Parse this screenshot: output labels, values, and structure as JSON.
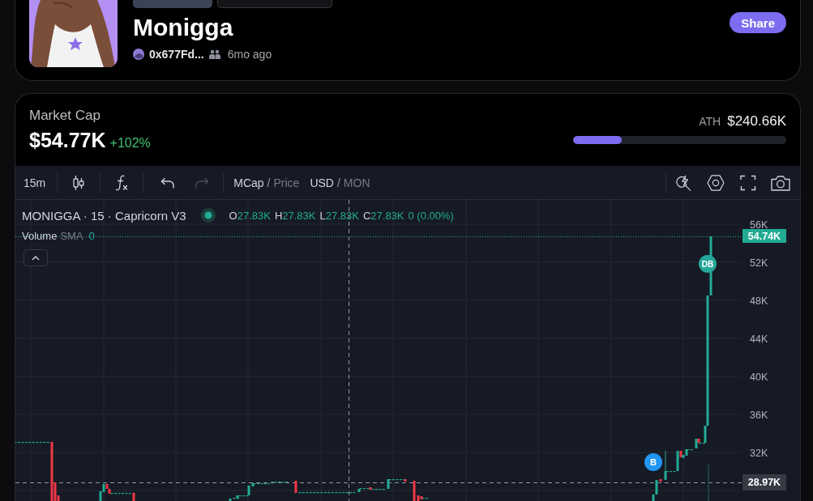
{
  "token": {
    "name": "Monigga",
    "creator": "0x677Fd...",
    "age": "6mo ago"
  },
  "share_button": {
    "label": "Share"
  },
  "market_cap": {
    "label": "Market Cap",
    "value": "$54.77K",
    "change": "+102%"
  },
  "ath": {
    "label": "ATH",
    "value": "$240.66K",
    "level": 0.23
  },
  "toolbar": {
    "interval": "15m",
    "undo": {
      "disabled": false
    },
    "redo": {
      "disabled": true
    },
    "price_mode": {
      "options": [
        {
          "label": "MCap",
          "selected": true
        },
        {
          "label": "Price",
          "selected": false
        }
      ],
      "separator": "/"
    },
    "currency": {
      "options": [
        {
          "label": "USD",
          "selected": true
        },
        {
          "label": "MON",
          "selected": false
        }
      ],
      "separator": "/"
    }
  },
  "legend": {
    "title": "MONIGGA · 15 · Capricorn V3",
    "ohlc": [
      {
        "key": "O",
        "value": "27.83K"
      },
      {
        "key": "H",
        "value": "27.83K"
      },
      {
        "key": "L",
        "value": "27.83K"
      },
      {
        "key": "C",
        "value": "27.83K"
      }
    ],
    "change": "0 (0.00%)"
  },
  "volume": {
    "label": "Volume",
    "indicator": "SMA",
    "value": "0"
  },
  "price_axis": {
    "ticks": [
      "56K",
      "52K",
      "48K",
      "44K",
      "40K",
      "36K",
      "32K"
    ],
    "last_price": "54.74K",
    "crosshair_price": "28.97K"
  },
  "markers": [
    {
      "label": "B",
      "color": "#2196f3"
    },
    {
      "label": "DB",
      "color": "#26a69a"
    }
  ]
}
